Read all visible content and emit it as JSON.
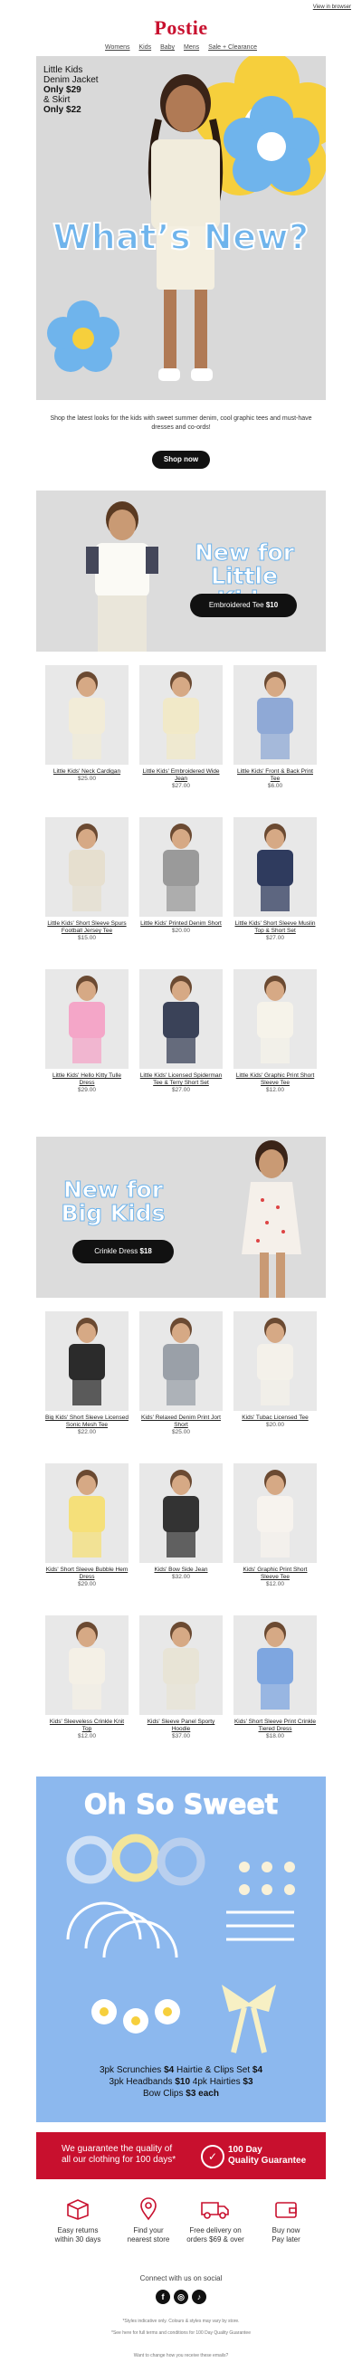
{
  "header": {
    "view_in_browser": "View in browser",
    "logo": "Postie",
    "nav": [
      "Womens",
      "Kids",
      "Baby",
      "Mens",
      "Sale + Clearance"
    ]
  },
  "hero": {
    "line1": "Little Kids",
    "line2": "Denim Jacket",
    "line3": "Only $29",
    "line4": "& Skirt",
    "line5": "Only $22",
    "title": "What’s New?"
  },
  "intro": {
    "text": "Shop the latest looks for the kids with sweet summer denim, cool graphic tees and must-have dresses and co-ords!",
    "button": "Shop now"
  },
  "little_kids": {
    "title_line1": "New for",
    "title_line2": "Little Kids",
    "pill_label": "Embroidered Tee",
    "pill_price": "$10",
    "products": [
      {
        "name": "Little Kids' Neck Cardigan",
        "price": "$25.00"
      },
      {
        "name": "Little Kids' Embroidered Wide Jean",
        "price": "$27.00"
      },
      {
        "name": "Little Kids' Front & Back Print Tee",
        "price": "$6.00"
      },
      {
        "name": "Little Kids' Short Sleeve Spurs Football Jersey Tee",
        "price": "$15.00"
      },
      {
        "name": "Little Kids' Printed Denim Short",
        "price": "$20.00"
      },
      {
        "name": "Little Kids' Short Sleeve Muslin Top & Short Set",
        "price": "$27.00"
      },
      {
        "name": "Little Kids' Hello Kitty Tulle Dress",
        "price": "$29.00"
      },
      {
        "name": "Little Kids' Licensed Spiderman Tee & Terry Short Set",
        "price": "$27.00"
      },
      {
        "name": "Little Kids' Graphic Print Short Sleeve Tee",
        "price": "$12.00"
      }
    ]
  },
  "big_kids": {
    "title_line1": "New for",
    "title_line2": "Big Kids",
    "pill_label": "Crinkle Dress",
    "pill_price": "$18",
    "products": [
      {
        "name": "Big Kids' Short Sleeve Licensed Sonic Mesh Tee",
        "price": "$22.00"
      },
      {
        "name": "Kids' Relaxed Denim Print Jort Short",
        "price": "$25.00"
      },
      {
        "name": "Kids' Tubac Licensed Tee",
        "price": "$20.00"
      },
      {
        "name": "Kids' Short Sleeve Bubble Hem Dress",
        "price": "$29.00"
      },
      {
        "name": "Kids' Bow Side Jean",
        "price": "$32.00"
      },
      {
        "name": "Kids' Graphic Print Short Sleeve Tee",
        "price": "$12.00"
      },
      {
        "name": "Kids' Sleeveless Crinkle Knit Top",
        "price": "$12.00"
      },
      {
        "name": "Kids' Sleeve Panel Sporty Hoodie",
        "price": "$37.00"
      },
      {
        "name": "Kids' Short Sleeve Print Crinkle Tiered Dress",
        "price": "$18.00"
      }
    ]
  },
  "sweet": {
    "title": "Oh So Sweet",
    "line1_a": "3pk Scrunchies",
    "line1_b": "$4",
    "line1_c": "Hairtie & Clips Set",
    "line1_d": "$4",
    "line2_a": "3pk Headbands",
    "line2_b": "$10",
    "line2_c": "4pk Hairties",
    "line2_d": "$3",
    "line3_a": "Bow Clips",
    "line3_b": "$3 each"
  },
  "guarantee": {
    "text_line1": "We guarantee the quality of",
    "text_line2": "all our clothing for 100 days*",
    "badge_line1": "100 Day",
    "badge_line2": "Quality Guarantee"
  },
  "features": [
    {
      "line1": "Easy returns",
      "line2": "within 30 days",
      "icon": "box-icon"
    },
    {
      "line1": "Find your",
      "line2": "nearest store",
      "icon": "map-pin-icon"
    },
    {
      "line1": "Free delivery on",
      "line2": "orders $69 & over",
      "icon": "truck-icon"
    },
    {
      "line1": "Buy now",
      "line2": "Pay later",
      "icon": "wallet-icon"
    }
  ],
  "footer": {
    "connect": "Connect with us on social",
    "fine1": "*Styles indicative only. Colours & styles may vary by store.",
    "fine2": "*See here for full terms and conditions for 100 Day Quality Guarantee",
    "fine3": "Want to change how you receive these emails?"
  },
  "colors": {
    "brand_red": "#c8102e",
    "accent_blue": "#6fb4ec",
    "sweet_blue": "#8cb8ee",
    "flower_yellow": "#f6cf3c"
  }
}
